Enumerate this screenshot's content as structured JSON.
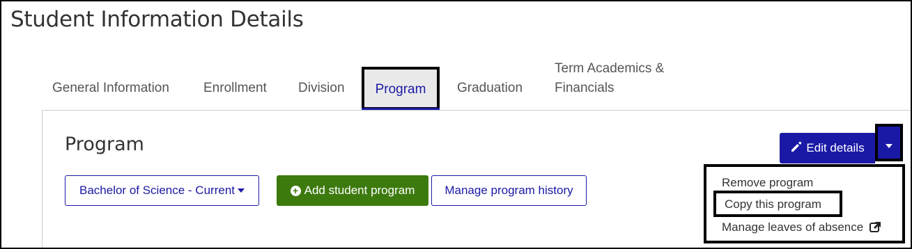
{
  "page": {
    "title": "Student Information Details"
  },
  "tabs": [
    {
      "label": "General Information"
    },
    {
      "label": "Enrollment"
    },
    {
      "label": "Division"
    },
    {
      "label": "Program"
    },
    {
      "label": "Graduation"
    },
    {
      "label": "Term Academics & Financials"
    }
  ],
  "section": {
    "title": "Program",
    "program_select": "Bachelor of Science - Current",
    "add_program": "Add student program",
    "manage_history": "Manage program history",
    "edit_details": "Edit details"
  },
  "menu": {
    "remove": "Remove program",
    "copy": "Copy this program",
    "leaves": "Manage leaves of absence"
  },
  "colors": {
    "primary": "#1a19a6",
    "success": "#3d7a0e"
  }
}
